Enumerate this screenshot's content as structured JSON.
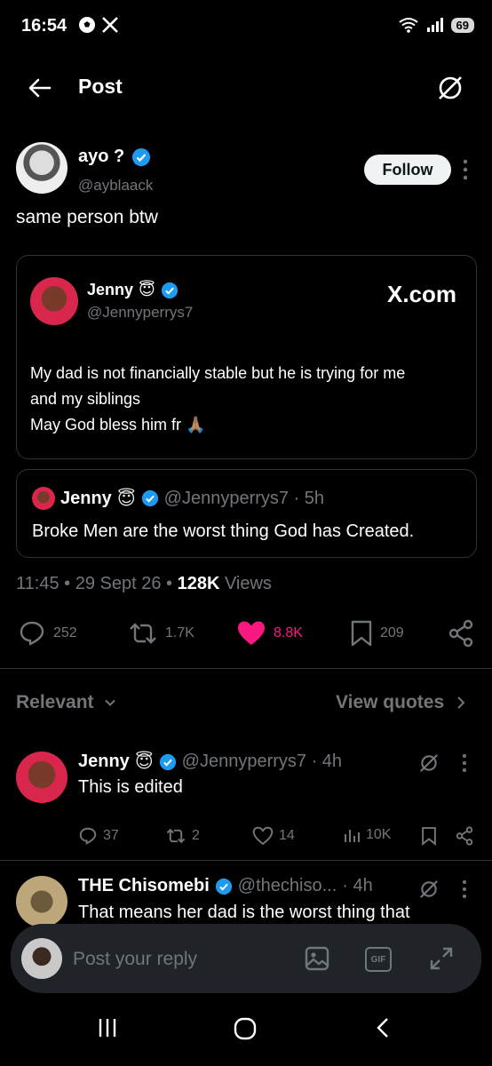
{
  "status_bar": {
    "time": "16:54",
    "battery": "69",
    "app_icons": [
      "soccer-ball-icon",
      "x-logo-icon"
    ]
  },
  "header": {
    "title": "Post"
  },
  "post": {
    "author_name": "ayo ?",
    "author_handle": "@ayblaack",
    "follow_label": "Follow",
    "text": "same person btw",
    "quoted": {
      "name": "Jenny",
      "emoji": "😇",
      "handle": "@Jennyperrys7",
      "source": "X.com",
      "lines": [
        "My dad is not financially stable but he is trying for me",
        "and my siblings",
        "May God bless him fr 🙏🏽"
      ]
    },
    "nested_quote": {
      "name": "Jenny",
      "emoji": "😇",
      "handle_time": "@Jennyperrys7 · 5h",
      "text": "Broke Men are the worst thing God has Created."
    },
    "meta": {
      "time": "11:45",
      "dot1": " • ",
      "date": "29 Sept 26",
      "dot2": " • ",
      "views_count": "128K",
      "views_label": " Views"
    },
    "actions": {
      "replies": "252",
      "reposts": "1.7K",
      "likes": "8.8K",
      "bookmarks": "209"
    }
  },
  "filter": {
    "relevant_label": "Relevant",
    "view_quotes_label": "View quotes"
  },
  "replies": [
    {
      "name": "Jenny",
      "emoji": "😇",
      "handle_time": "@Jennyperrys7 · 4h",
      "text": "This is edited",
      "replies": "37",
      "reposts": "2",
      "likes": "14",
      "views": "10K"
    },
    {
      "name": "THE Chisomebi",
      "handle": "@thechiso...",
      "time": "· 4h",
      "text": "That means her dad is the worst thing that"
    }
  ],
  "composer": {
    "placeholder": "Post your reply",
    "gif_label": "GIF"
  },
  "colors": {
    "verified": "#1d9bf0",
    "like": "#f91880",
    "bg": "#000000",
    "muted": "#71767b"
  }
}
